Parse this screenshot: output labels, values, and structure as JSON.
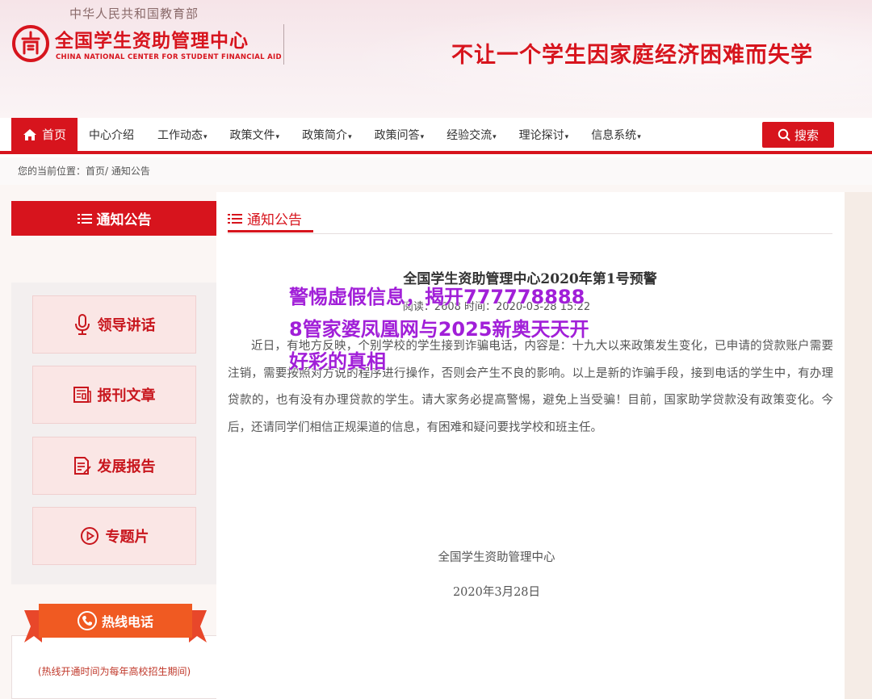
{
  "header": {
    "ministry": "中华人民共和国教育部",
    "logo_cn": "全国学生资助管理中心",
    "logo_en": "CHINA NATIONAL CENTER FOR STUDENT FINANCIAL AID",
    "slogan": "不让一个学生因家庭经济困难而失学"
  },
  "nav": {
    "home": "首页",
    "items": [
      {
        "label": "中心介绍",
        "caret": ""
      },
      {
        "label": "工作动态",
        "caret": "▾"
      },
      {
        "label": "政策文件",
        "caret": "▾"
      },
      {
        "label": "政策简介",
        "caret": "▾"
      },
      {
        "label": "政策问答",
        "caret": "▾"
      },
      {
        "label": "经验交流",
        "caret": "▾"
      },
      {
        "label": "理论探讨",
        "caret": "▾"
      },
      {
        "label": "信息系统",
        "caret": "▾"
      }
    ],
    "search": "搜索"
  },
  "breadcrumb": "您的当前位置：首页/ 通知公告",
  "sidebar": {
    "title": "通知公告",
    "menu": [
      {
        "label": "领导讲话",
        "icon": "microphone-icon"
      },
      {
        "label": "报刊文章",
        "icon": "newspaper-icon"
      },
      {
        "label": "发展报告",
        "icon": "report-icon"
      },
      {
        "label": "专题片",
        "icon": "play-icon"
      }
    ],
    "hotline": "热线电话",
    "hotline_note": "(热线开通时间为每年高校招生期间)"
  },
  "main": {
    "section_title": "通知公告",
    "article": {
      "title": "全国学生资助管理中心2020年第1号预警",
      "meta": "阅读：2608 时间：2020-03-28 15:22",
      "body": "近日，有地方反映，个别学校的学生接到诈骗电话，内容是：十九大以来政策发生变化，已申请的贷款账户需要注销，需要按照对方说的程序进行操作，否则会产生不良的影响。以上是新的诈骗手段，接到电话的学生中，有办理贷款的，也有没有办理贷款的学生。请大家务必提高警惕，避免上当受骗！目前，国家助学贷款没有政策变化。今后，还请同学们相信正规渠道的信息，有困难和疑问要找学校和班主任。",
      "signature": "全国学生资助管理中心",
      "date": "2020年3月28日"
    }
  },
  "overlay": {
    "text": "警惕虚假信息，揭开7777788888管家婆凤凰网与2025新奥天天开好彩的真相"
  },
  "colors": {
    "brand_red": "#d7141d",
    "overlay_purple": "#a11fd8"
  }
}
